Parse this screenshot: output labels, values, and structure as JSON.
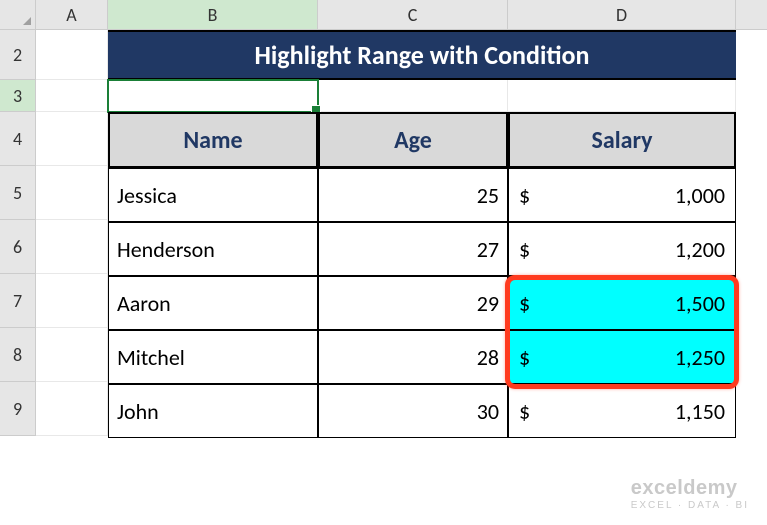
{
  "columns": [
    "A",
    "B",
    "C",
    "D"
  ],
  "row_numbers": [
    2,
    3,
    4,
    5,
    6,
    7,
    8,
    9
  ],
  "title": "Highlight Range with Condition",
  "headers": {
    "name": "Name",
    "age": "Age",
    "salary": "Salary"
  },
  "active_cell": "B3",
  "currency_symbol": "$",
  "highlight_color": "#00ffff",
  "chart_data": {
    "type": "table",
    "columns": [
      "Name",
      "Age",
      "Salary"
    ],
    "rows": [
      {
        "name": "Jessica",
        "age": 25,
        "salary": 1000,
        "salary_display": "1,000",
        "highlighted": false
      },
      {
        "name": "Henderson",
        "age": 27,
        "salary": 1200,
        "salary_display": "1,200",
        "highlighted": false
      },
      {
        "name": "Aaron",
        "age": 29,
        "salary": 1500,
        "salary_display": "1,500",
        "highlighted": true
      },
      {
        "name": "Mitchel",
        "age": 28,
        "salary": 1250,
        "salary_display": "1,250",
        "highlighted": true
      },
      {
        "name": "John",
        "age": 30,
        "salary": 1150,
        "salary_display": "1,150",
        "highlighted": false
      }
    ],
    "highlight_condition": "salary >= 1250 (cells D7:D8 highlighted cyan)",
    "title": "Highlight Range with Condition"
  },
  "watermark": {
    "line1": "exceldemy",
    "line2": "EXCEL · DATA · BI"
  }
}
